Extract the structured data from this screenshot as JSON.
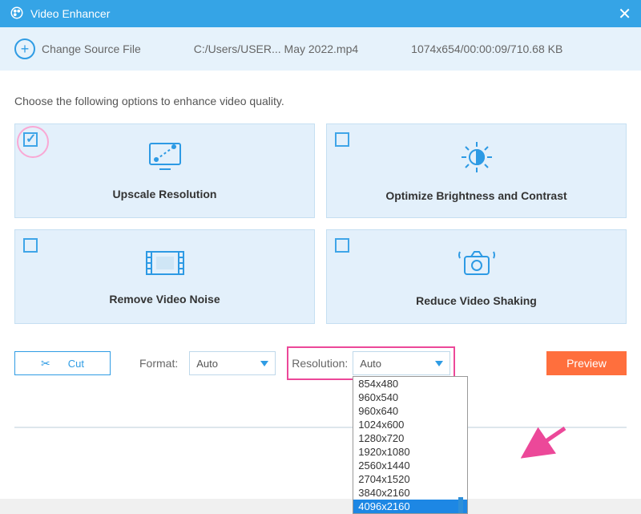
{
  "titlebar": {
    "title": "Video Enhancer"
  },
  "toolbar": {
    "change_source": "Change Source File",
    "file_path": "C:/Users/USER... May 2022.mp4",
    "file_meta": "1074x654/00:00:09/710.68 KB"
  },
  "instruction": "Choose the following options to enhance video quality.",
  "cards": {
    "upscale": {
      "title": "Upscale Resolution",
      "checked": true
    },
    "brightness": {
      "title": "Optimize Brightness and Contrast",
      "checked": false
    },
    "noise": {
      "title": "Remove Video Noise",
      "checked": false
    },
    "shaking": {
      "title": "Reduce Video Shaking",
      "checked": false
    }
  },
  "controls": {
    "cut": "Cut",
    "format_label": "Format:",
    "format_value": "Auto",
    "resolution_label": "Resolution:",
    "resolution_value": "Auto",
    "preview": "Preview"
  },
  "resolution_options": [
    "854x480",
    "960x540",
    "960x640",
    "1024x600",
    "1280x720",
    "1920x1080",
    "2560x1440",
    "2704x1520",
    "3840x2160",
    "4096x2160"
  ],
  "highlighted_option_index": 9
}
